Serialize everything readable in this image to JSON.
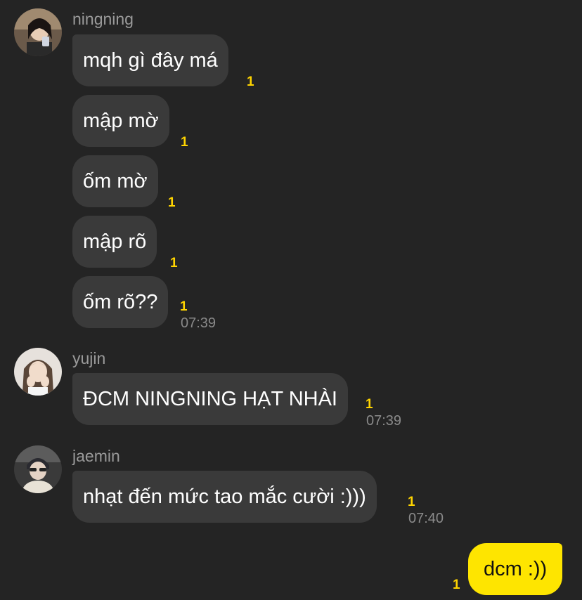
{
  "messages": [
    {
      "sender": "ningning",
      "avatar": "avatar-ningning",
      "lines": [
        {
          "text": "mqh gì đây má",
          "unread": "1"
        },
        {
          "text": "mập mờ",
          "unread": "1"
        },
        {
          "text": "ốm mờ",
          "unread": "1"
        },
        {
          "text": "mập rõ",
          "unread": "1"
        },
        {
          "text": "ốm rõ??",
          "unread": "1"
        }
      ],
      "time": "07:39"
    },
    {
      "sender": "yujin",
      "avatar": "avatar-yujin",
      "lines": [
        {
          "text": "ĐCM NINGNING HẠT NHÀI",
          "unread": "1"
        }
      ],
      "time": "07:39"
    },
    {
      "sender": "jaemin",
      "avatar": "avatar-jaemin",
      "lines": [
        {
          "text": "nhạt đến mức tao mắc cười :)))",
          "unread": "1"
        }
      ],
      "time": "07:40"
    }
  ],
  "my_message": {
    "text": "dcm :))",
    "unread": "1"
  },
  "colors": {
    "background": "#242424",
    "bubble": "#3a3a3a",
    "my_bubble": "#fee500",
    "unread": "#ffd400"
  }
}
